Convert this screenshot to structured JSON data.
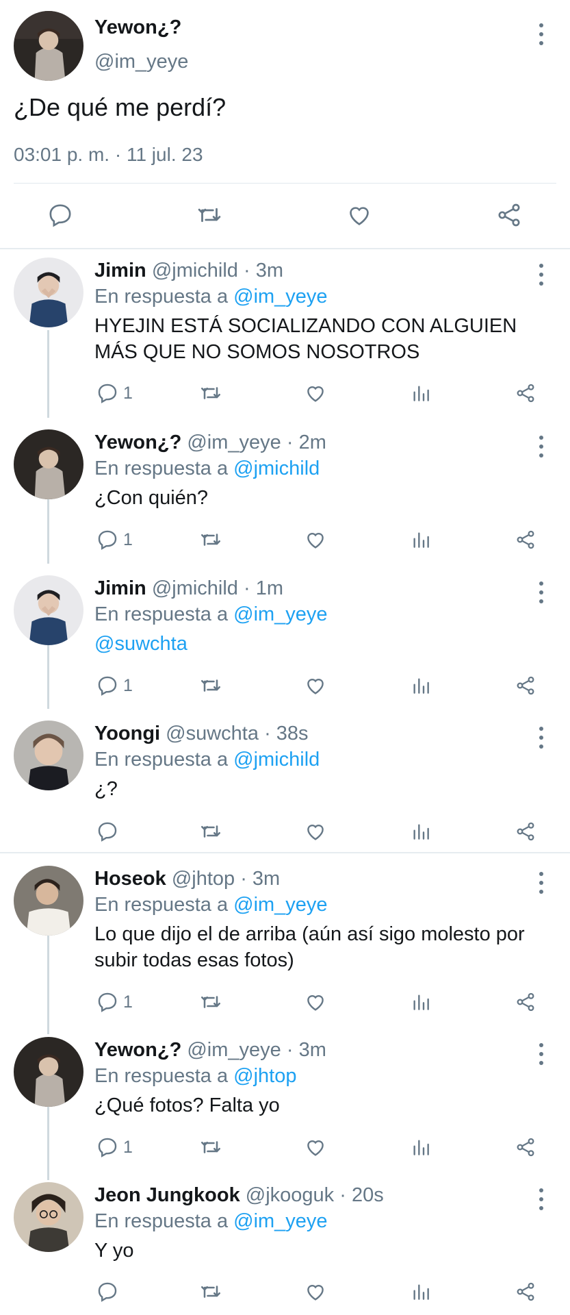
{
  "main_tweet": {
    "name": "Yewon¿?",
    "handle": "@im_yeye",
    "text": "¿De qué me perdí?",
    "timestamp": "03:01 p. m. · 11 jul. 23"
  },
  "labels": {
    "in_reply_to": "En respuesta a"
  },
  "colors": {
    "link": "#1da1f2",
    "secondary_text": "#657786",
    "divider": "#e1e8ed"
  },
  "replies": [
    {
      "name": "Jimin",
      "handle": "@jmichild",
      "time": "· 3m",
      "reply_to": "@im_yeye",
      "text": "HYEJIN ESTÁ SOCIALIZANDO CON ALGUIEN MÁS QUE NO SOMOS NOSOTROS",
      "replies_count": "1",
      "avatar": "hands-portrait"
    },
    {
      "name": "Yewon¿?",
      "handle": "@im_yeye",
      "time": "· 2m",
      "reply_to": "@jmichild",
      "text": "¿Con quién?",
      "replies_count": "1",
      "avatar": "sweater-portrait"
    },
    {
      "name": "Jimin",
      "handle": "@jmichild",
      "time": "· 1m",
      "reply_to": "@im_yeye",
      "text": "@suwchta",
      "replies_count": "1",
      "avatar": "hands-portrait"
    },
    {
      "name": "Yoongi",
      "handle": "@suwchta",
      "time": "· 38s",
      "reply_to": "@jmichild",
      "text": "¿?",
      "replies_count": "",
      "avatar": "face-portrait"
    },
    {
      "name": "Hoseok",
      "handle": "@jhtop",
      "time": "· 3m",
      "reply_to": "@im_yeye",
      "text": "Lo que dijo el de arriba (aún así sigo molesto por subir todas esas fotos)",
      "replies_count": "1",
      "avatar": "white-shirt-portrait"
    },
    {
      "name": "Yewon¿?",
      "handle": "@im_yeye",
      "time": "· 3m",
      "reply_to": "@jhtop",
      "text": "¿Qué fotos? Falta yo",
      "replies_count": "1",
      "avatar": "sweater-portrait"
    },
    {
      "name": "Jeon Jungkook",
      "handle": "@jkooguk",
      "time": "· 20s",
      "reply_to": "@im_yeye",
      "text": "Y yo",
      "replies_count": "",
      "avatar": "glasses-portrait"
    }
  ]
}
